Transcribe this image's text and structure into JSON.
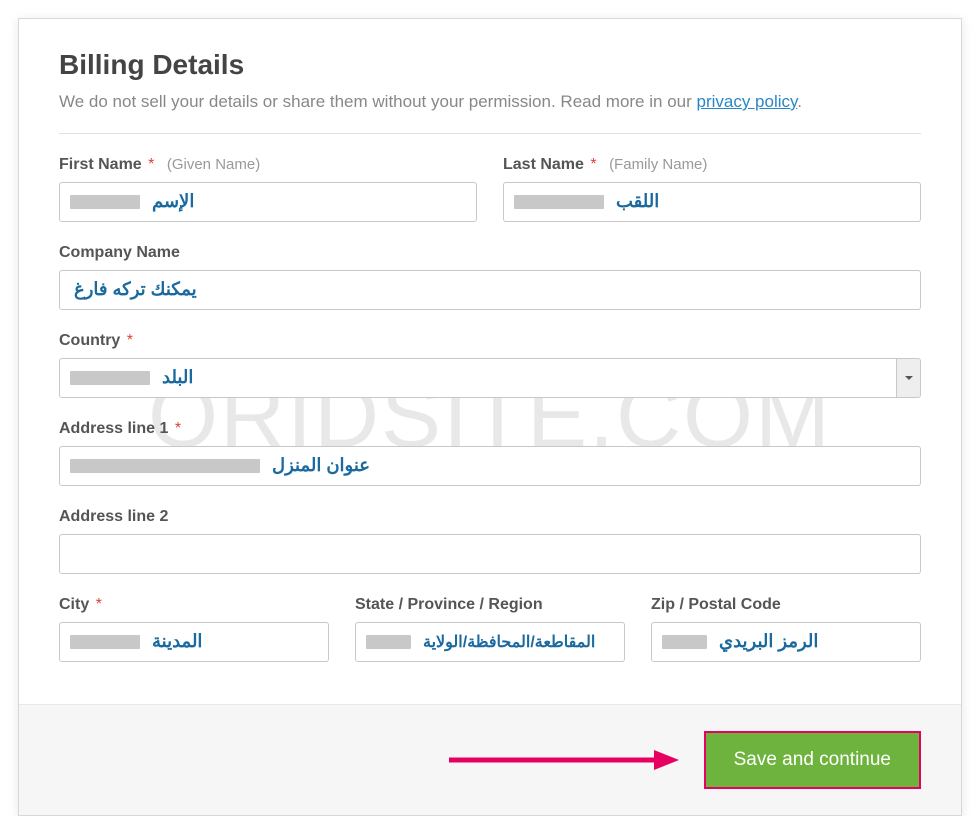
{
  "watermark_text": "ORIDSITE.COM",
  "heading": "Billing Details",
  "subtitle_prefix": "We do not sell your details or share them without your permission. Read more in our ",
  "privacy_link_text": "privacy policy",
  "subtitle_suffix": ".",
  "fields": {
    "first_name": {
      "label": "First Name",
      "hint": "(Given Name)",
      "annotation": "الإسم"
    },
    "last_name": {
      "label": "Last Name",
      "hint": "(Family Name)",
      "annotation": "اللقب"
    },
    "company": {
      "label": "Company Name",
      "annotation": "يمكنك تركه فارغ"
    },
    "country": {
      "label": "Country",
      "annotation": "البلد"
    },
    "address1": {
      "label": "Address line 1",
      "annotation": "عنوان المنزل"
    },
    "address2": {
      "label": "Address line 2"
    },
    "city": {
      "label": "City",
      "annotation": "المدينة"
    },
    "state": {
      "label": "State / Province / Region",
      "annotation": "المقاطعة/المحافظة/الولاية"
    },
    "zip": {
      "label": "Zip / Postal Code",
      "annotation": "الرمز البريدي"
    }
  },
  "required_mark": "*",
  "save_button": "Save and continue",
  "colors": {
    "accent_green": "#6fb33f",
    "highlight_pink": "#e60060",
    "link_blue": "#2a87c7",
    "annotation_blue": "#1a6aa0"
  }
}
